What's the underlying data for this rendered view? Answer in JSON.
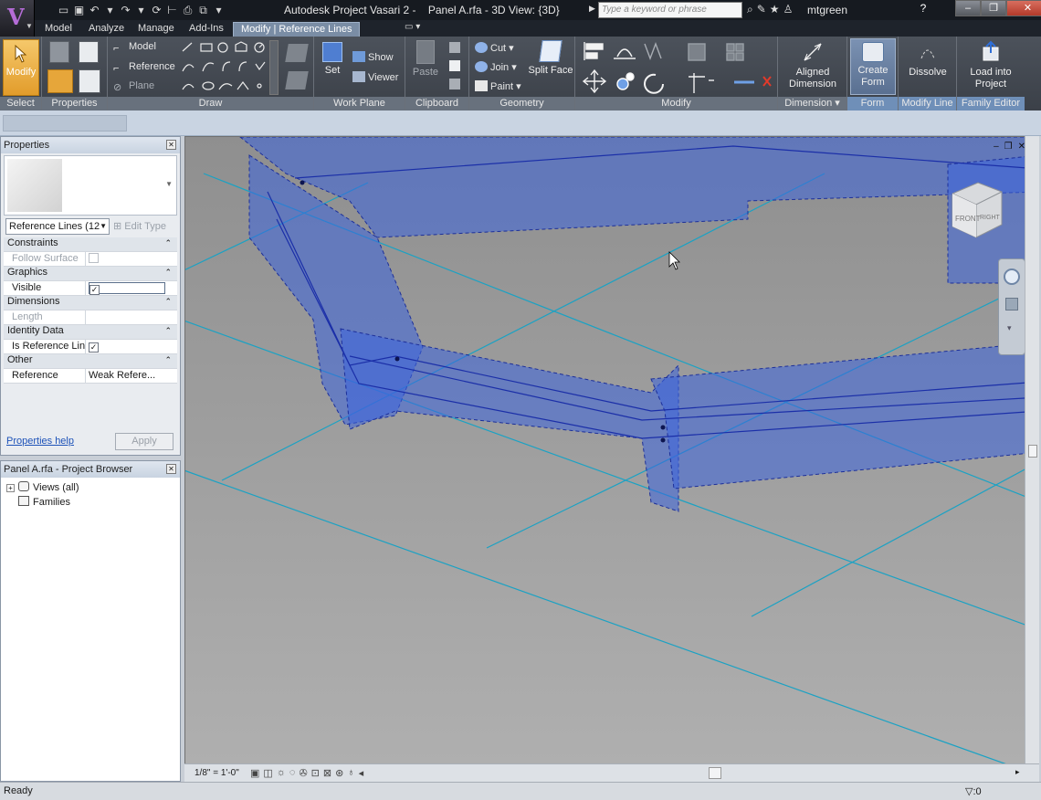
{
  "app": {
    "title": "Autodesk Project Vasari 2 -    Panel A.rfa - 3D View: {3D}",
    "search_placeholder": "Type a keyword or phrase",
    "user": "mtgreen",
    "help": "?"
  },
  "ribbon_tabs": [
    "Model",
    "Analyze",
    "Manage",
    "Add-Ins",
    "Modify | Reference Lines"
  ],
  "ribbon": {
    "select": {
      "modify": "Modify",
      "label": "Select"
    },
    "properties": {
      "label": "Properties"
    },
    "draw": {
      "model": "Model",
      "reference": "Reference",
      "plane": "Plane",
      "label": "Draw"
    },
    "work_plane": {
      "set": "Set",
      "show": "Show",
      "viewer": "Viewer",
      "label": "Work Plane"
    },
    "clipboard": {
      "paste": "Paste",
      "label": "Clipboard"
    },
    "geometry": {
      "cut": "Cut",
      "join": "Join",
      "paint": "Paint",
      "split_face": "Split Face",
      "label": "Geometry"
    },
    "modify": {
      "label": "Modify"
    },
    "dimension": {
      "aligned_1": "Aligned",
      "aligned_2": "Dimension",
      "label": "Dimension"
    },
    "form": {
      "create_1": "Create",
      "create_2": "Form",
      "label": "Form"
    },
    "modify_line": {
      "dissolve": "Dissolve",
      "label": "Modify Line"
    },
    "family_editor": {
      "load_1": "Load into",
      "load_2": "Project",
      "label": "Family Editor"
    }
  },
  "properties_palette": {
    "title": "Properties",
    "selector": "Reference Lines (12",
    "edit_type": "Edit Type",
    "rows": [
      {
        "kind": "category",
        "label": "Constraints"
      },
      {
        "kind": "param",
        "key": "Follow Surface",
        "value": "",
        "checkbox": true,
        "checked": false,
        "disabled": true
      },
      {
        "kind": "category",
        "label": "Graphics"
      },
      {
        "kind": "param",
        "key": "Visible",
        "value": "",
        "checkbox": true,
        "checked": true,
        "disabled": false
      },
      {
        "kind": "category",
        "label": "Dimensions"
      },
      {
        "kind": "param",
        "key": "Length",
        "value": "",
        "checkbox": false,
        "checked": false,
        "disabled": true
      },
      {
        "kind": "category",
        "label": "Identity Data"
      },
      {
        "kind": "param",
        "key": "Is Reference Line",
        "value": "",
        "checkbox": true,
        "checked": true,
        "disabled": false
      },
      {
        "kind": "category",
        "label": "Other"
      },
      {
        "kind": "param",
        "key": "Reference",
        "value": "Weak Refere...",
        "checkbox": false,
        "checked": false,
        "disabled": false
      }
    ],
    "help_link": "Properties help",
    "apply": "Apply"
  },
  "project_browser": {
    "title": "Panel A.rfa - Project Browser",
    "items": [
      "Views (all)",
      "Families"
    ]
  },
  "viewport": {
    "view_cube_front": "FRONT",
    "view_cube_right": "RIGHT",
    "scale": "1/8\" = 1'-0\""
  },
  "status": {
    "text": "Ready",
    "filter": ":0"
  },
  "colors": {
    "accent_tab": "#7a8da5",
    "form_blue": "#3a64d9",
    "grid_cyan": "#19a6c8",
    "modify_orange": "#e9a737"
  }
}
